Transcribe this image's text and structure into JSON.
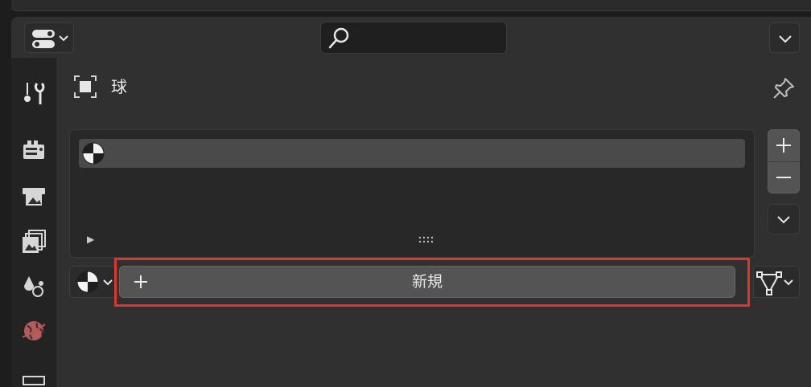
{
  "header": {
    "editor_type_icon": "properties-editor-icon",
    "search": {
      "placeholder": "",
      "value": ""
    }
  },
  "tabs": [
    {
      "name": "tool",
      "icon": "tool-icon"
    },
    {
      "name": "render",
      "icon": "render-icon"
    },
    {
      "name": "output",
      "icon": "output-icon"
    },
    {
      "name": "view-layer",
      "icon": "view-layer-icon"
    },
    {
      "name": "scene",
      "icon": "scene-icon"
    },
    {
      "name": "world",
      "icon": "world-icon"
    },
    {
      "name": "object",
      "icon": "object-icon"
    }
  ],
  "context": {
    "object_name": "球",
    "icon": "object-icon"
  },
  "material_slots": {
    "rows": [
      {
        "name": "",
        "icon": "material-sphere-icon"
      }
    ]
  },
  "material_selector": {
    "new_label": "新規"
  },
  "colors": {
    "highlight": "#e0362a",
    "panel": "#303030",
    "button": "#545454"
  }
}
